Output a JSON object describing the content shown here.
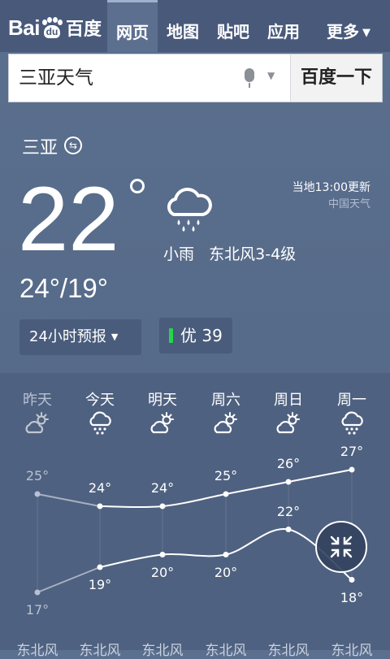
{
  "header": {
    "logo_text": "Bai",
    "logo_paw_text": "du",
    "logo_cn": "百度",
    "tabs": [
      {
        "label": "网页",
        "active": true
      },
      {
        "label": "地图"
      },
      {
        "label": "贴吧"
      },
      {
        "label": "应用"
      },
      {
        "label": "更多"
      }
    ]
  },
  "search": {
    "query": "三亚天气",
    "button_label": "百度一下"
  },
  "current": {
    "city": "三亚",
    "temp": "22",
    "condition": "小雨",
    "wind": "东北风3-4级",
    "updated": "当地13:00更新",
    "source": "中国天气",
    "range": "24°/19°",
    "forecast_button": "24小时预报",
    "aqi_label": "优 39",
    "aqi_color": "#26d64a"
  },
  "forecast": {
    "days": [
      {
        "name": "昨天",
        "icon": "partly-cloudy-icon",
        "high": "25°",
        "low": "17°",
        "wind": "东北风"
      },
      {
        "name": "今天",
        "icon": "light-rain-icon",
        "high": "24°",
        "low": "19°",
        "wind": "东北风"
      },
      {
        "name": "明天",
        "icon": "partly-cloudy-icon",
        "high": "24°",
        "low": "20°",
        "wind": "东北风"
      },
      {
        "name": "周六",
        "icon": "partly-cloudy-icon",
        "high": "25°",
        "low": "20°",
        "wind": "东北风"
      },
      {
        "name": "周日",
        "icon": "partly-cloudy-icon",
        "high": "26°",
        "low": "22°",
        "wind": "东北风"
      },
      {
        "name": "周一",
        "icon": "light-rain-icon",
        "high": "27°",
        "low": "18°",
        "wind": "东北风"
      }
    ]
  }
}
